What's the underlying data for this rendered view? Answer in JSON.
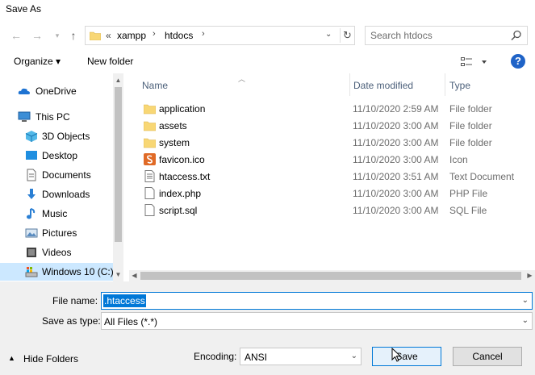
{
  "window": {
    "title": "Save As"
  },
  "address": {
    "overflow": "«",
    "crumbs": [
      "xampp",
      "htdocs"
    ]
  },
  "search": {
    "placeholder": "Search htdocs"
  },
  "toolbar": {
    "organize": "Organize ▾",
    "new_folder": "New folder",
    "help": "?"
  },
  "nav": {
    "items": [
      {
        "label": "OneDrive",
        "icon": "onedrive-icon"
      },
      {
        "label": "This PC",
        "icon": "this-pc-icon"
      },
      {
        "label": "3D Objects",
        "icon": "3d-objects-icon"
      },
      {
        "label": "Desktop",
        "icon": "desktop-icon"
      },
      {
        "label": "Documents",
        "icon": "documents-icon"
      },
      {
        "label": "Downloads",
        "icon": "downloads-icon"
      },
      {
        "label": "Music",
        "icon": "music-icon"
      },
      {
        "label": "Pictures",
        "icon": "pictures-icon"
      },
      {
        "label": "Videos",
        "icon": "videos-icon"
      },
      {
        "label": "Windows 10 (C:)",
        "icon": "drive-icon"
      }
    ]
  },
  "columns": {
    "name": "Name",
    "date": "Date modified",
    "type": "Type"
  },
  "files": [
    {
      "name": "application",
      "date": "11/10/2020 2:59 AM",
      "type": "File folder",
      "icon": "folder-icon"
    },
    {
      "name": "assets",
      "date": "11/10/2020 3:00 AM",
      "type": "File folder",
      "icon": "folder-icon"
    },
    {
      "name": "system",
      "date": "11/10/2020 3:00 AM",
      "type": "File folder",
      "icon": "folder-icon"
    },
    {
      "name": "favicon.ico",
      "date": "11/10/2020 3:00 AM",
      "type": "Icon",
      "icon": "ico-file-icon"
    },
    {
      "name": "htaccess.txt",
      "date": "11/10/2020 3:51 AM",
      "type": "Text Document",
      "icon": "text-file-icon"
    },
    {
      "name": "index.php",
      "date": "11/10/2020 3:00 AM",
      "type": "PHP File",
      "icon": "file-icon"
    },
    {
      "name": "script.sql",
      "date": "11/10/2020 3:00 AM",
      "type": "SQL File",
      "icon": "file-icon"
    }
  ],
  "form": {
    "file_name_label": "File name:",
    "file_name_value": ".htaccess",
    "save_type_label": "Save as type:",
    "save_type_value": "All Files  (*.*)",
    "hide_folders": "Hide Folders",
    "encoding_label": "Encoding:",
    "encoding_value": "ANSI",
    "save": "Save",
    "cancel": "Cancel"
  },
  "colors": {
    "accent": "#0078d7",
    "selection": "#cce8ff",
    "folder": "#f8d775"
  }
}
